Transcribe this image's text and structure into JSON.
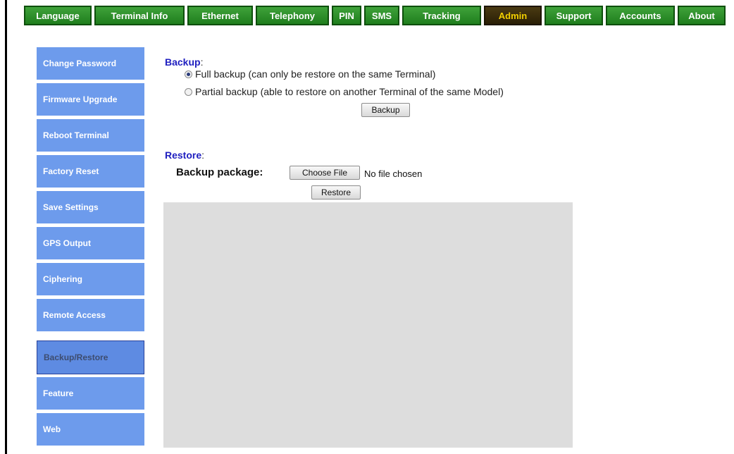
{
  "nav": {
    "tabs": [
      {
        "label": "Language"
      },
      {
        "label": "Terminal Info"
      },
      {
        "label": "Ethernet"
      },
      {
        "label": "Telephony"
      },
      {
        "label": "PIN"
      },
      {
        "label": "SMS"
      },
      {
        "label": "Tracking"
      },
      {
        "label": "Admin",
        "active": true
      },
      {
        "label": "Support"
      },
      {
        "label": "Accounts"
      },
      {
        "label": "About"
      }
    ]
  },
  "sidebar": {
    "items": [
      {
        "label": "Change Password"
      },
      {
        "label": "Firmware Upgrade"
      },
      {
        "label": "Reboot Terminal"
      },
      {
        "label": "Factory Reset"
      },
      {
        "label": "Save Settings"
      },
      {
        "label": "GPS Output"
      },
      {
        "label": "Ciphering"
      },
      {
        "label": "Remote Access"
      },
      {
        "label": "Backup/Restore",
        "active": true
      },
      {
        "label": "Feature"
      },
      {
        "label": "Web"
      }
    ]
  },
  "backup": {
    "title": "Backup",
    "colon": ":",
    "option_full": "Full backup (can only be restore on the same Terminal)",
    "option_partial": "Partial backup (able to restore on another Terminal of the same Model)",
    "selected": "full",
    "button_label": "Backup"
  },
  "restore": {
    "title": "Restore",
    "colon": ":",
    "package_label": "Backup package:",
    "choose_file_label": "Choose File",
    "file_status": "No file chosen",
    "button_label": "Restore"
  },
  "colors": {
    "nav_tab": "#2a8a27",
    "nav_active_text": "#f3d000",
    "sidebar_item": "#6d9bec",
    "section_title": "#2020c0"
  }
}
